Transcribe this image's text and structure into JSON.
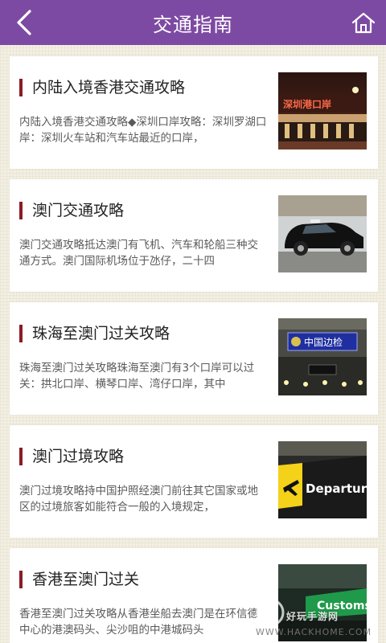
{
  "header": {
    "title": "交通指南",
    "background_color": "#7d4aa3",
    "back_icon": "chevron-left-icon",
    "home_icon": "home-icon"
  },
  "articles": [
    {
      "title": "内陆入境香港交通攻略",
      "summary": "内陆入境香港交通攻略◆深圳口岸攻略：深圳罗湖口岸：深圳火车站和汽车站最近的口岸，",
      "image": "shenzhen-border-port-night-photo",
      "image_text": "深圳港口岸"
    },
    {
      "title": "澳门交通攻略",
      "summary": "澳门交通攻略抵达澳门有飞机、汽车和轮船三种交通方式。澳门国际机场位于氹仔，二十四",
      "image": "macau-taxi-photo"
    },
    {
      "title": "珠海至澳门过关攻略",
      "summary": "珠海至澳门过关攻略珠海至澳门有3个口岸可以过关：拱北口岸、横琴口岸、湾仔口岸，其中",
      "image": "china-border-inspection-hall-photo",
      "image_text": "中国边检"
    },
    {
      "title": "澳门过境攻略",
      "summary": "澳门过境攻略持中国护照经澳门前往其它国家或地区的过境旅客如能符合一般的入境规定，",
      "image": "departure-sign-photo",
      "image_text": "Departure"
    },
    {
      "title": "香港至澳门过关",
      "summary": "香港至澳门过关攻略从香港坐船去澳门是在环信德中心的港澳码头、尖沙咀的中港城码头",
      "image": "customs-sign-photo",
      "image_text": "Customs"
    }
  ],
  "watermark": {
    "text": "好玩手游网",
    "url": "WWW.HACKHOME.COM"
  },
  "colors": {
    "title_bar_accent": "#8b1c24",
    "background": "#f3efe2"
  }
}
